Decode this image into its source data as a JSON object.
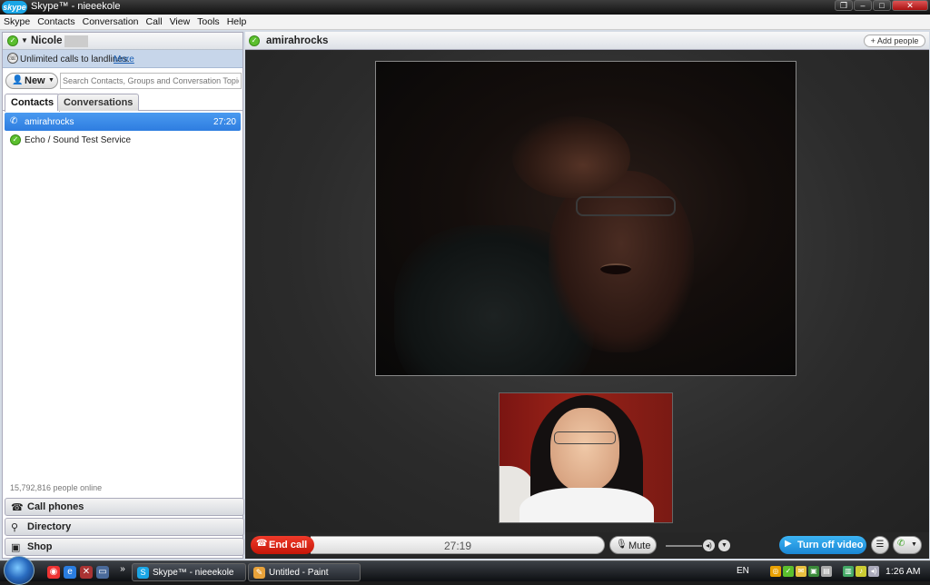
{
  "window": {
    "title": "Skype™ - nieeekole",
    "logo": "skype",
    "buttons": [
      "restore-icon",
      "minimize-icon",
      "maximize-icon",
      "close-icon"
    ]
  },
  "menu": [
    "Skype",
    "Contacts",
    "Conversation",
    "Call",
    "View",
    "Tools",
    "Help"
  ],
  "profile": {
    "name": "Nicole",
    "status_icon": "online-check-icon"
  },
  "promo": {
    "text": "Unlimited calls to landlines.",
    "link": "More"
  },
  "toolbar": {
    "new_label": "New",
    "search_placeholder": "Search Contacts, Groups and Conversation Topics"
  },
  "tabs": [
    {
      "label": "Contacts",
      "active": true
    },
    {
      "label": "Conversations",
      "active": false
    }
  ],
  "contacts": [
    {
      "name": "amirahrocks",
      "time": "27:20",
      "icon": "phone-icon",
      "selected": true
    },
    {
      "name": "Echo / Sound Test Service",
      "time": "",
      "icon": "online-check-icon",
      "selected": false
    }
  ],
  "online_count": "15,792,816 people online",
  "left_buttons": [
    {
      "label": "Call phones",
      "icon": "phone-handset-icon"
    },
    {
      "label": "Directory",
      "icon": "magnifier-icon"
    },
    {
      "label": "Shop",
      "icon": "shopping-bag-icon"
    }
  ],
  "conversation": {
    "contact_name": "amirahrocks",
    "add_people_label": "+ Add people"
  },
  "call": {
    "end_call_label": "End call",
    "timer": "27:19",
    "mute_label": "Mute",
    "turn_off_video_label": "Turn off video"
  },
  "taskbar": {
    "items": [
      {
        "label": "Skype™ - nieeekole",
        "icon": "skype-icon"
      },
      {
        "label": "Untitled - Paint",
        "icon": "paint-icon"
      }
    ],
    "overflow": "»",
    "language": "EN",
    "clock": "1:26 AM"
  },
  "colors": {
    "accent_blue": "#2e7de0",
    "end_call_red": "#d81e10",
    "video_blue": "#1a86d4",
    "online_green": "#5bbf2e"
  }
}
